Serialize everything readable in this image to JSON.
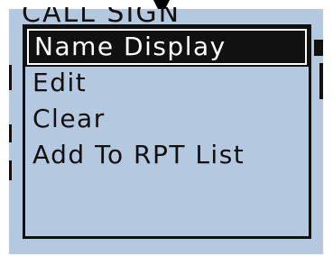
{
  "screen": {
    "background_title": "CALL SIGN",
    "lcd_color": "#b4c8df"
  },
  "menu": {
    "items": [
      {
        "label": "Name Display",
        "selected": true
      },
      {
        "label": "Edit",
        "selected": false
      },
      {
        "label": "Clear",
        "selected": false
      },
      {
        "label": "Add To RPT List",
        "selected": false
      }
    ]
  }
}
